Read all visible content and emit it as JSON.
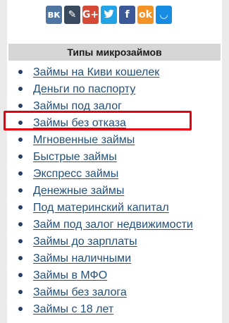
{
  "share": {
    "buttons": [
      {
        "name": "vk-share-button",
        "icon": "vk-icon",
        "glyph": "вк",
        "color": "#4f76a3"
      },
      {
        "name": "livejournal-share-button",
        "icon": "livejournal-pen-icon",
        "glyph": "✎",
        "color": "#3a4a5e"
      },
      {
        "name": "google-plus-share-button",
        "icon": "google-plus-icon",
        "glyph": "G+",
        "color": "#d64937"
      },
      {
        "name": "twitter-share-button",
        "icon": "twitter-bird-icon",
        "glyph": "",
        "color": "#22a3e6"
      },
      {
        "name": "facebook-share-button",
        "icon": "facebook-icon",
        "glyph": "f",
        "color": "#3b5998"
      },
      {
        "name": "odnoklassniki-share-button",
        "icon": "odnoklassniki-icon",
        "glyph": "ok",
        "color": "#f39325"
      },
      {
        "name": "moimir-share-button",
        "icon": "moimir-smile-icon",
        "glyph": "◡",
        "color": "#168de2"
      }
    ]
  },
  "sidebar": {
    "title": "Типы микрозаймов",
    "highlighted_index": 3,
    "highlight_color": "#e60012",
    "links": [
      "Займы на Киви кошелек",
      "Деньги по паспорту",
      "Займы под залог",
      "Займы без отказа",
      "Мгновенные займы",
      "Быстрые займы",
      "Экспресс займы",
      "Денежные займы",
      "Под материнский капитал",
      "Займ под залог недвижимости",
      "Займы до зарплаты",
      "Займы наличными",
      "Займы в МФО",
      "Займы без залога",
      "Займы с 18 лет"
    ]
  }
}
